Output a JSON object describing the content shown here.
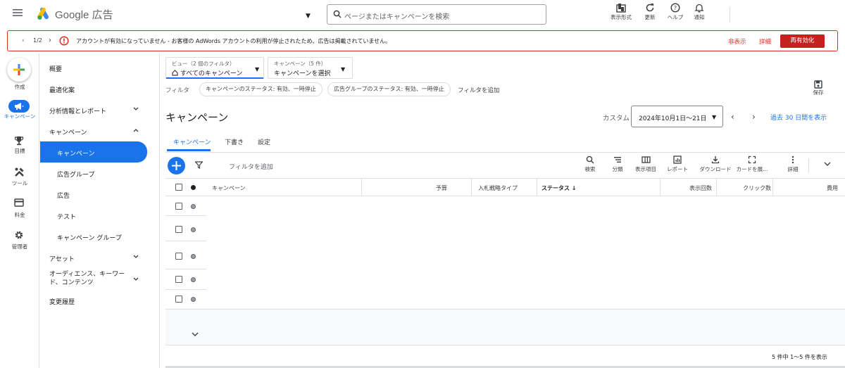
{
  "header": {
    "brand": "Google 広告",
    "search_placeholder": "ページまたはキャンペーンを検索",
    "buttons": {
      "appearance": "表示形式",
      "refresh": "更新",
      "help": "ヘルプ",
      "notifications": "通知"
    }
  },
  "alert": {
    "page": "1/2",
    "message": "アカウントが有効になっていません - お客様の AdWords アカウントの利用が停止されたため、広告は掲載されていません。",
    "hide": "非表示",
    "details": "詳細",
    "reactivate": "再有効化"
  },
  "rail": {
    "create": "作成",
    "campaigns": "キャンペーン",
    "goals": "目標",
    "tools": "ツール",
    "billing": "料金",
    "admin": "管理者"
  },
  "nav": {
    "overview": "概要",
    "recommendations": "最適化案",
    "insights": "分析情報とレポート",
    "campaigns_group": "キャンペーン",
    "campaigns": "キャンペーン",
    "ad_groups": "広告グループ",
    "ads": "広告",
    "experiments": "テスト",
    "campaign_groups": "キャンペーン グループ",
    "assets": "アセット",
    "audiences": "オーディエンス、キーワード、コンテンツ",
    "change_history": "変更履歴"
  },
  "view": {
    "small": "ビュー（2 個のフィルタ）",
    "main": "すべてのキャンペーン"
  },
  "campaign_select": {
    "small": "キャンペーン（5 件）",
    "main": "キャンペーンを選択"
  },
  "filters": {
    "label": "フィルタ",
    "chips": [
      "キャンペーンのステータス: 有効、一時停止",
      "広告グループのステータス: 有効、一時停止"
    ],
    "add": "フィルタを追加",
    "save": "保存"
  },
  "page": {
    "title": "キャンペーン",
    "custom": "カスタム",
    "date_range": "2024年10月1日～21日",
    "last30": "過去 30 日間を表示"
  },
  "tabs": [
    "キャンペーン",
    "下書き",
    "設定"
  ],
  "toolbar": {
    "add_filter": "フィルタを追加",
    "tools": [
      "検索",
      "分類",
      "表示項目",
      "レポート",
      "ダウンロード",
      "カードを展...",
      "詳細"
    ]
  },
  "table": {
    "columns": {
      "campaign": "キャンペーン",
      "budget": "予算",
      "bid_strategy": "入札戦略タイプ",
      "status": "ステータス ↓",
      "impressions": "表示回数",
      "clicks": "クリック数",
      "cost": "費用"
    },
    "footer": "5 件中 1～5 件を表示"
  },
  "colors": {
    "accent": "#1a73e8",
    "alert": "#d93025",
    "reactivate": "#c5221f"
  }
}
